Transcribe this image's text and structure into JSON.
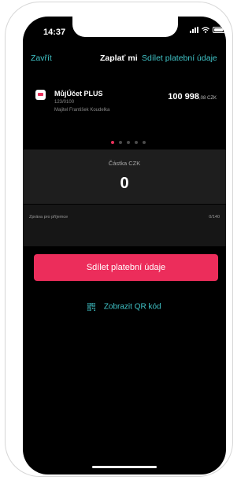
{
  "status_bar": {
    "time": "14:37"
  },
  "nav": {
    "close_label": "Zavřít",
    "title": "Zaplať mi",
    "share_link": "Sdílet platební údaje"
  },
  "account": {
    "name": "MůjÚčet PLUS",
    "number": "123/0100",
    "owner": "Majitel František Koudelka",
    "balance_main": "100 998",
    "balance_small": ",08 CZK"
  },
  "pager": {
    "count": 5,
    "active_index": 0
  },
  "amount": {
    "label": "Částka CZK",
    "value": "0"
  },
  "message": {
    "placeholder": "Zpráva pro příjemce",
    "counter": "0/140"
  },
  "actions": {
    "share_button": "Sdílet platební údaje",
    "qr_link": "Zobrazit QR kód"
  },
  "colors": {
    "accent": "#ec2d5b",
    "link": "#40c4c8",
    "background": "#000000"
  }
}
